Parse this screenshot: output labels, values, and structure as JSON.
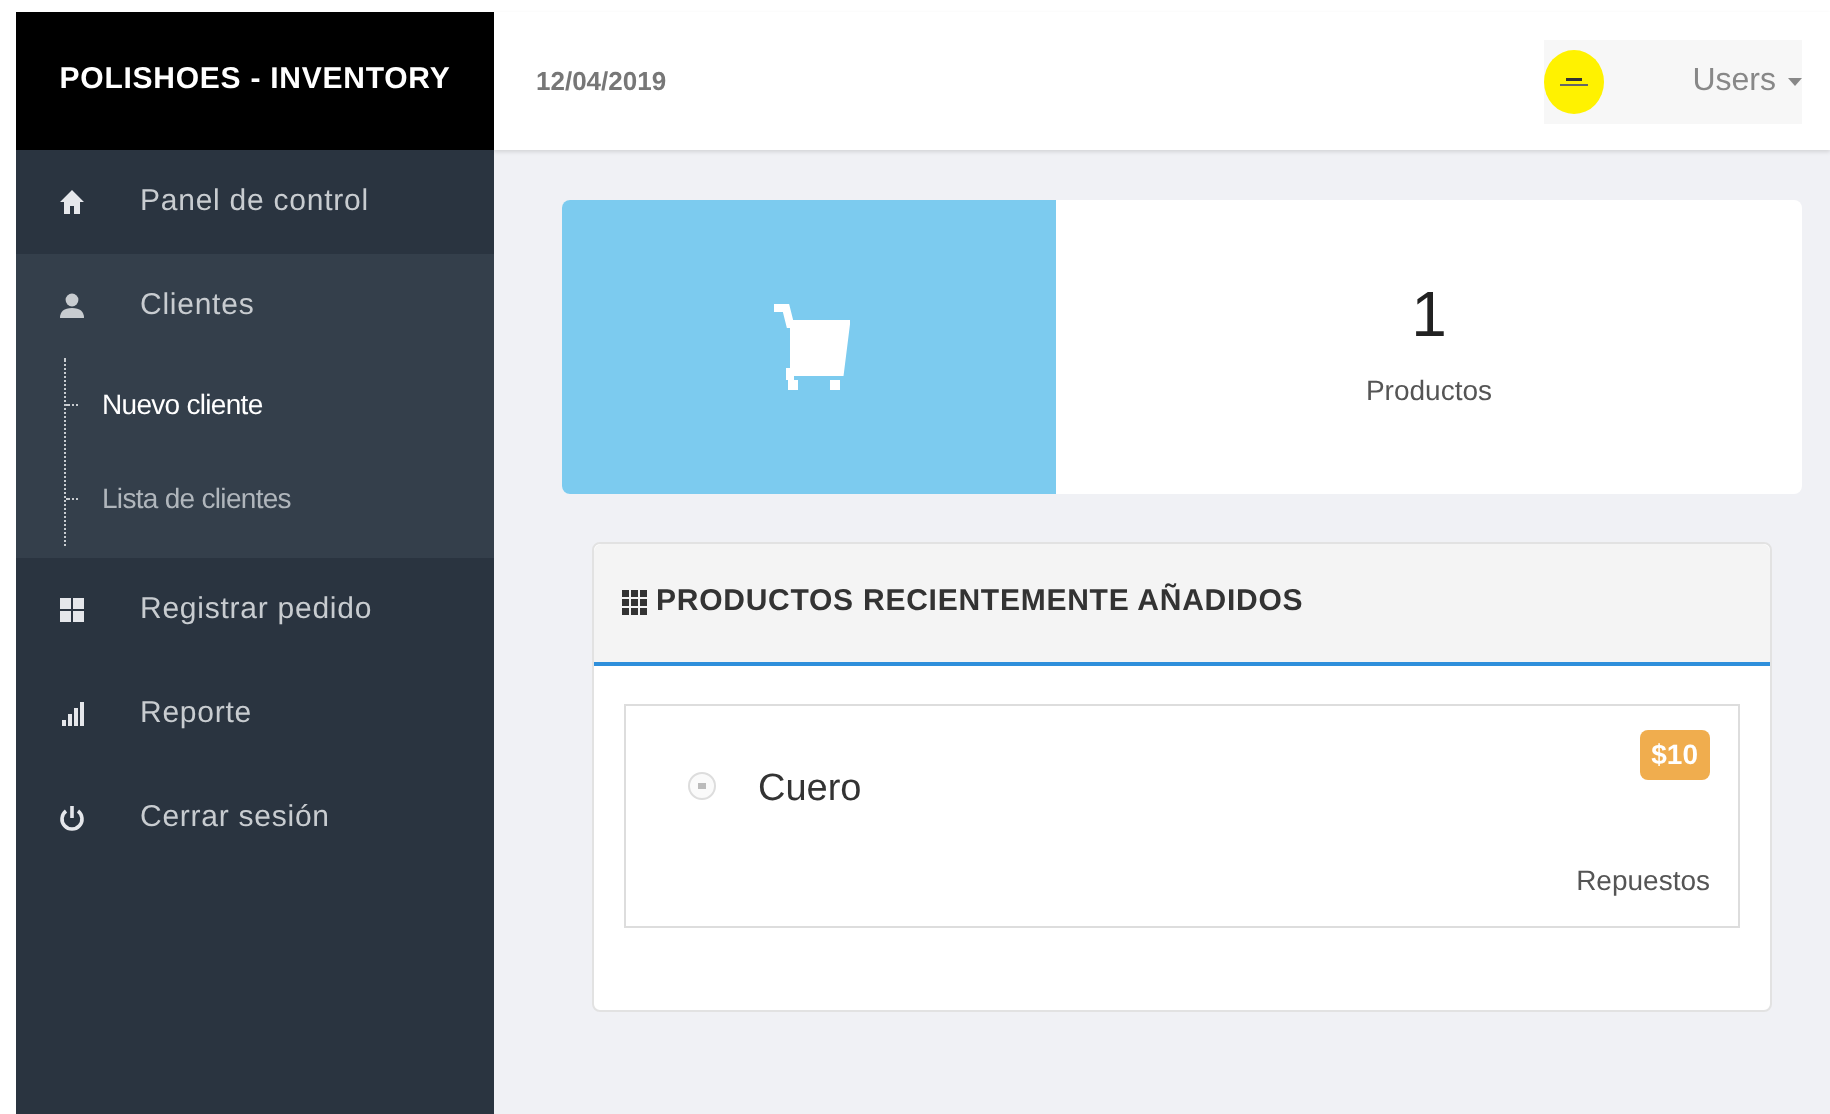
{
  "brand": "POLISHOES - INVENTORY",
  "date": "12/04/2019",
  "user_menu": {
    "label": "Users"
  },
  "sidebar": {
    "items": [
      {
        "label": "Panel de control",
        "kind": "home",
        "expanded": false
      },
      {
        "label": "Clientes",
        "kind": "user",
        "expanded": true,
        "children": [
          {
            "label": "Nuevo cliente",
            "selected": true
          },
          {
            "label": "Lista de clientes",
            "selected": false
          }
        ]
      },
      {
        "label": "Registrar pedido",
        "kind": "grid",
        "expanded": false
      },
      {
        "label": "Reporte",
        "kind": "bars",
        "expanded": false
      },
      {
        "label": "Cerrar sesión",
        "kind": "power",
        "expanded": false
      }
    ]
  },
  "stat_card": {
    "value": "1",
    "label": "Productos"
  },
  "recent_panel": {
    "title": "PRODUCTOS RECIENTEMENTE AÑADIDOS",
    "products": [
      {
        "name": "Cuero",
        "price": "$10",
        "category": "Repuestos"
      }
    ]
  }
}
